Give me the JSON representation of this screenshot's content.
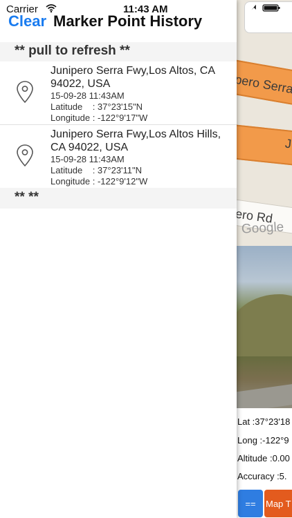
{
  "status_bar": {
    "carrier": "Carrier",
    "time": "11:43 AM"
  },
  "nav": {
    "clear_label": "Clear",
    "title": "Marker Point History"
  },
  "list": {
    "header": "** pull to refresh **",
    "footer": "** **",
    "items": [
      {
        "address_line1": "Junipero Serra Fwy,Los Altos, CA",
        "address_line2": "94022, USA",
        "datetime": "15-09-28 11:43AM",
        "latitude": "Latitude    : 37°23'15\"N",
        "longitude": "Longitude : -122°9'17\"W"
      },
      {
        "address_line1": "Junipero Serra Fwy,Los Altos Hills,",
        "address_line2": "CA 94022, USA",
        "datetime": "15-09-28 11:43AM",
        "latitude": "Latitude    : 37°23'11\"N",
        "longitude": "Longitude : -122°9'12\"W"
      }
    ]
  },
  "map": {
    "road_label_1": "pero Serra",
    "road_label_2": "J",
    "road_label_3": "ero Rd",
    "watermark": "Google"
  },
  "info": {
    "lat": "Lat :37°23'18",
    "long": "Long :-122°9",
    "altitude": "Altitude :0.00",
    "accuracy": "Accuracy :5."
  },
  "buttons": {
    "menu_label": "==",
    "map_type_label": "Map T"
  },
  "colors": {
    "accent": "#1a7cf0",
    "map_road": "#f29a4a",
    "button_blue": "#2f7de1",
    "button_orange": "#e35b1e"
  }
}
